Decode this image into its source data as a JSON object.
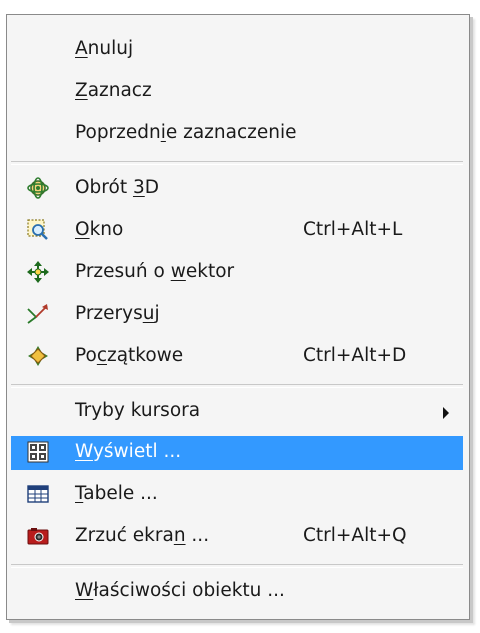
{
  "menu": {
    "items": [
      {
        "pre": "",
        "key": "A",
        "post": "nuluj",
        "shortcut": "",
        "icon": ""
      },
      {
        "pre": "",
        "key": "Z",
        "post": "aznacz",
        "shortcut": "",
        "icon": ""
      },
      {
        "pre": "Poprzedn",
        "key": "i",
        "post": "e zaznaczenie",
        "shortcut": "",
        "icon": ""
      },
      {
        "pre": "Obrót ",
        "key": "3",
        "post": "D",
        "shortcut": "",
        "icon": "orbit-3d-icon"
      },
      {
        "pre": "",
        "key": "O",
        "post": "kno",
        "shortcut": "Ctrl+Alt+L",
        "icon": "zoom-window-icon"
      },
      {
        "pre": "Przesuń o ",
        "key": "w",
        "post": "ektor",
        "shortcut": "",
        "icon": "pan-icon"
      },
      {
        "pre": "Przerys",
        "key": "u",
        "post": "j",
        "shortcut": "",
        "icon": "redraw-icon"
      },
      {
        "pre": "Po",
        "key": "c",
        "post": "zątkowe",
        "shortcut": "Ctrl+Alt+D",
        "icon": "home-view-icon"
      },
      {
        "pre": "Tryby kursora",
        "key": "",
        "post": "",
        "shortcut": "",
        "icon": "",
        "submenu": true
      },
      {
        "pre": "",
        "key": "W",
        "post": "yświetl ...",
        "shortcut": "",
        "icon": "display-grid-icon",
        "highlighted": true
      },
      {
        "pre": "",
        "key": "T",
        "post": "abele ...",
        "shortcut": "",
        "icon": "table-icon"
      },
      {
        "pre": "Zrzuć ekra",
        "key": "n",
        "post": " ...",
        "shortcut": "Ctrl+Alt+Q",
        "icon": "screenshot-camera-icon"
      },
      {
        "pre": "",
        "key": "W",
        "post": "łaściwości obiektu ...",
        "shortcut": "",
        "icon": ""
      }
    ]
  },
  "colors": {
    "highlight": "#3399ff",
    "menu_background": "#f5f5f5"
  }
}
